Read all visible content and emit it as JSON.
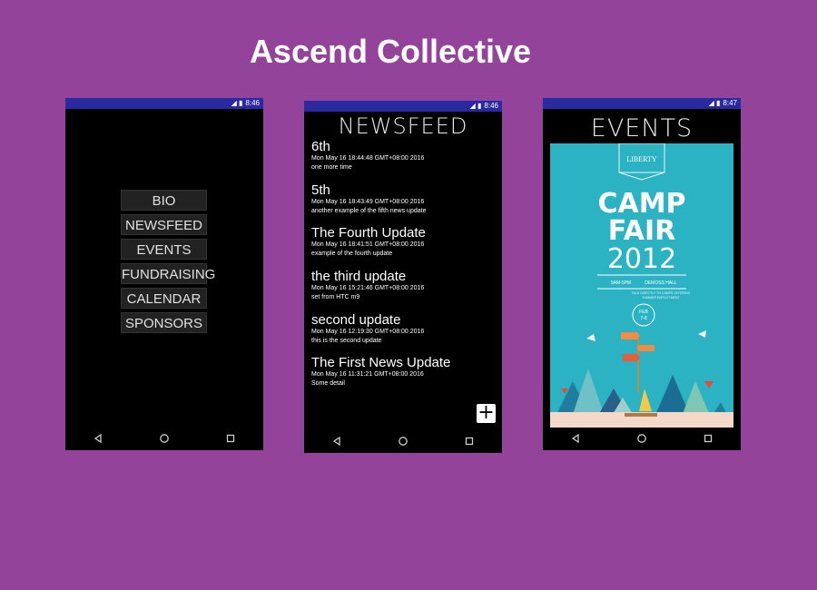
{
  "page": {
    "title": "Ascend Collective"
  },
  "phones": {
    "menu": {
      "status_time": "8:46",
      "items": [
        "BIO",
        "NEWSFEED",
        "EVENTS",
        "FUNDRAISING",
        "CALENDAR",
        "SPONSORS"
      ]
    },
    "newsfeed": {
      "status_time": "8:46",
      "heading": "NEWSFEED",
      "add_label": "+",
      "items": [
        {
          "title": "6th",
          "meta": "Mon May 16 18:44:48 GMT+08:00 2016",
          "body": "one more time"
        },
        {
          "title": "5th",
          "meta": "Mon May 16 18:43:49 GMT+08:00 2016",
          "body": "another example of the fifth news update"
        },
        {
          "title": "The Fourth Update",
          "meta": "Mon May 16 18:41:51 GMT+08:00 2016",
          "body": "example of the fourth update"
        },
        {
          "title": "the third update",
          "meta": "Mon May 16 15:21:46 GMT+08:00 2016",
          "body": "set from HTC m9"
        },
        {
          "title": "second update",
          "meta": "Mon May 16 12:19:30 GMT+08:00 2016",
          "body": "this is the second update"
        },
        {
          "title": "The First News Update",
          "meta": "Mon May 16 11:31:21 GMT+08:00 2016",
          "body": "Some detail"
        }
      ]
    },
    "events": {
      "status_time": "8:47",
      "heading": "EVENTS",
      "poster": {
        "logo_line1": "LIBERTY",
        "title_line1": "CAMP",
        "title_line2": "FAIR",
        "year": "2012",
        "time": "9AM-5PM",
        "venue": "DEMOSS HALL",
        "note1": "TALK DIRECTLY TO CAMPS OFFERING",
        "note2": "SUMMER EMPLOYMENT",
        "date1": "FEB",
        "date2": "7-8"
      }
    }
  },
  "colors": {
    "background": "#93439a",
    "statusbar": "#2a2aa0",
    "poster": "#2bb3c4"
  }
}
